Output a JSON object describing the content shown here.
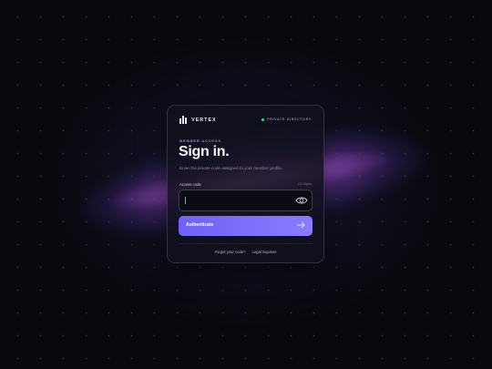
{
  "brand": {
    "name": "VERTEX",
    "icon": "bar-chart-logo-icon"
  },
  "directory": {
    "label": "PRIVATE DIRECTORY",
    "status_color": "#3ddc97"
  },
  "form": {
    "eyebrow": "MEMBER ACCESS",
    "title": "Sign in.",
    "subtitle": "Enter the private code assigned to your member profile.",
    "field_label": "Access code",
    "field_hint": "4-6 digits",
    "value": "",
    "placeholder": "",
    "reveal_icon": "eye-icon",
    "submit_label": "Authenticate",
    "submit_icon": "arrow-right-icon"
  },
  "links": {
    "forgot": "Forgot your code?",
    "legal": "Legal inquiries"
  },
  "colors": {
    "accent": "#7b6df8",
    "background": "#08080d",
    "eyebrow": "#8b84e8"
  }
}
